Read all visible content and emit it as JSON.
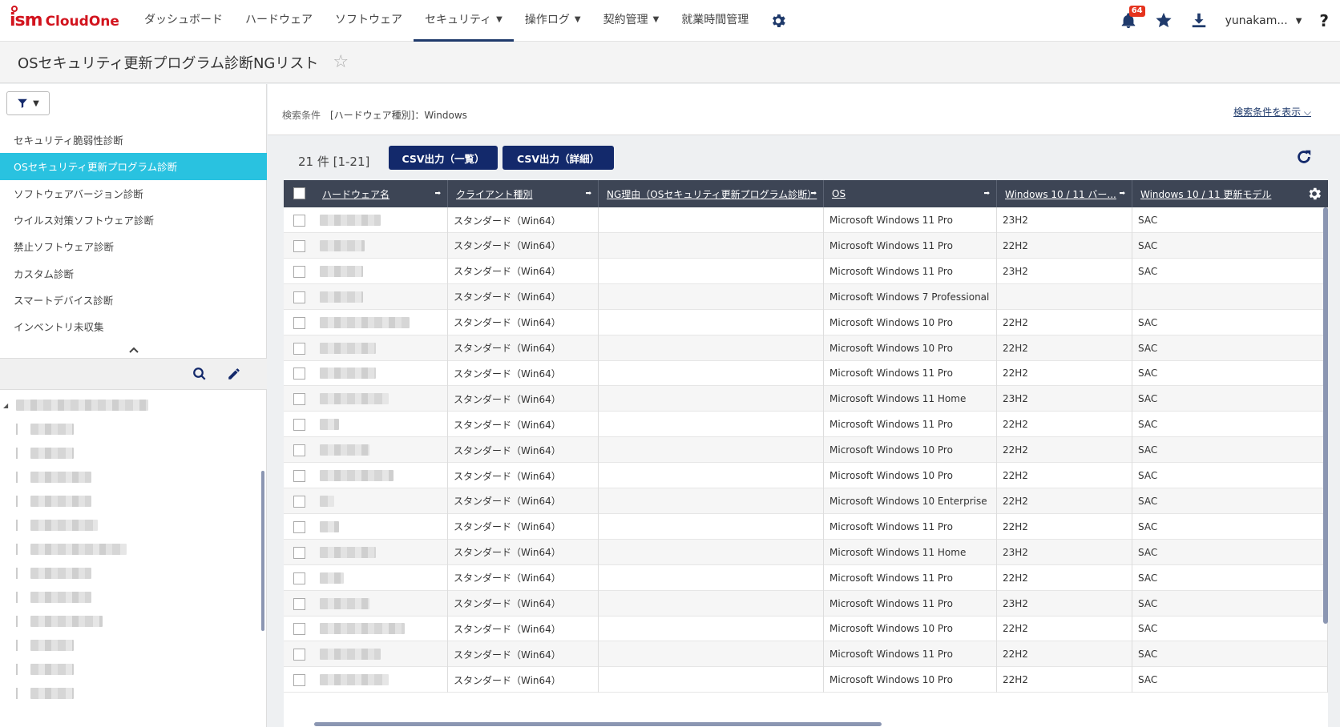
{
  "app": {
    "logo_ism": "ism",
    "logo_cloud": "CloudOne"
  },
  "nav": {
    "items": [
      {
        "label": "ダッシュボード",
        "caret": false,
        "active": false
      },
      {
        "label": "ハードウェア",
        "caret": false,
        "active": false
      },
      {
        "label": "ソフトウェア",
        "caret": false,
        "active": false
      },
      {
        "label": "セキュリティ",
        "caret": true,
        "active": true
      },
      {
        "label": "操作ログ",
        "caret": true,
        "active": false
      },
      {
        "label": "契約管理",
        "caret": true,
        "active": false
      },
      {
        "label": "就業時間管理",
        "caret": false,
        "active": false
      }
    ],
    "notification_count": "64",
    "user": "yunakam...",
    "help": "?"
  },
  "page": {
    "title": "OSセキュリティ更新プログラム診断NGリスト"
  },
  "sidebar": {
    "items": [
      {
        "label": "セキュリティ脆弱性診断",
        "active": false
      },
      {
        "label": "OSセキュリティ更新プログラム診断",
        "active": true
      },
      {
        "label": "ソフトウェアバージョン診断",
        "active": false
      },
      {
        "label": "ウイルス対策ソフトウェア診断",
        "active": false
      },
      {
        "label": "禁止ソフトウェア診断",
        "active": false
      },
      {
        "label": "カスタム診断",
        "active": false
      },
      {
        "label": "スマートデバイス診断",
        "active": false
      },
      {
        "label": "インベントリ未収集",
        "active": false
      }
    ]
  },
  "search": {
    "label": "検索条件",
    "value": "[ハードウェア種別]：Windows",
    "toggle": "検索条件を表示"
  },
  "result": {
    "count": "21 件 [1-21]",
    "csv_list": "CSV出力（一覧）",
    "csv_detail": "CSV出力（詳細）"
  },
  "table": {
    "columns": [
      {
        "label": "ハードウェア名"
      },
      {
        "label": "クライアント種別"
      },
      {
        "label": "NG理由（OSセキュリティ更新プログラム診断）"
      },
      {
        "label": "OS"
      },
      {
        "label": "Windows 10 / 11 バー..."
      },
      {
        "label": "Windows 10 / 11 更新モデル"
      }
    ],
    "rows": [
      {
        "client": "スタンダード（Win64）",
        "os": "Microsoft Windows 11 Pro",
        "ver": "23H2",
        "model": "SAC"
      },
      {
        "client": "スタンダード（Win64）",
        "os": "Microsoft Windows 11 Pro",
        "ver": "22H2",
        "model": "SAC"
      },
      {
        "client": "スタンダード（Win64）",
        "os": "Microsoft Windows 11 Pro",
        "ver": "23H2",
        "model": "SAC"
      },
      {
        "client": "スタンダード（Win64）",
        "os": "Microsoft Windows 7 Professional",
        "ver": "",
        "model": ""
      },
      {
        "client": "スタンダード（Win64）",
        "os": "Microsoft Windows 10 Pro",
        "ver": "22H2",
        "model": "SAC"
      },
      {
        "client": "スタンダード（Win64）",
        "os": "Microsoft Windows 10 Pro",
        "ver": "22H2",
        "model": "SAC"
      },
      {
        "client": "スタンダード（Win64）",
        "os": "Microsoft Windows 11 Pro",
        "ver": "22H2",
        "model": "SAC"
      },
      {
        "client": "スタンダード（Win64）",
        "os": "Microsoft Windows 11 Home",
        "ver": "23H2",
        "model": "SAC"
      },
      {
        "client": "スタンダード（Win64）",
        "os": "Microsoft Windows 11 Pro",
        "ver": "22H2",
        "model": "SAC"
      },
      {
        "client": "スタンダード（Win64）",
        "os": "Microsoft Windows 10 Pro",
        "ver": "22H2",
        "model": "SAC"
      },
      {
        "client": "スタンダード（Win64）",
        "os": "Microsoft Windows 10 Pro",
        "ver": "22H2",
        "model": "SAC"
      },
      {
        "client": "スタンダード（Win64）",
        "os": "Microsoft Windows 10 Enterprise",
        "ver": "22H2",
        "model": "SAC"
      },
      {
        "client": "スタンダード（Win64）",
        "os": "Microsoft Windows 11 Pro",
        "ver": "22H2",
        "model": "SAC"
      },
      {
        "client": "スタンダード（Win64）",
        "os": "Microsoft Windows 11 Home",
        "ver": "23H2",
        "model": "SAC"
      },
      {
        "client": "スタンダード（Win64）",
        "os": "Microsoft Windows 11 Pro",
        "ver": "22H2",
        "model": "SAC"
      },
      {
        "client": "スタンダード（Win64）",
        "os": "Microsoft Windows 11 Pro",
        "ver": "23H2",
        "model": "SAC"
      },
      {
        "client": "スタンダード（Win64）",
        "os": "Microsoft Windows 10 Pro",
        "ver": "22H2",
        "model": "SAC"
      },
      {
        "client": "スタンダード（Win64）",
        "os": "Microsoft Windows 11 Pro",
        "ver": "22H2",
        "model": "SAC"
      },
      {
        "client": "スタンダード（Win64）",
        "os": "Microsoft Windows 10 Pro",
        "ver": "22H2",
        "model": "SAC"
      }
    ]
  },
  "icons": {
    "gear": "gear-icon",
    "bell": "bell-icon",
    "star": "star-icon",
    "download": "download-icon",
    "filter": "filter-icon",
    "search": "search-icon",
    "edit": "pencil-icon",
    "refresh": "refresh-icon"
  },
  "colors": {
    "brand": "#d2141e",
    "nav_active": "#1f3a6b",
    "sidebar_active": "#29c2e0",
    "button": "#13296b",
    "table_header": "#3d4555"
  }
}
